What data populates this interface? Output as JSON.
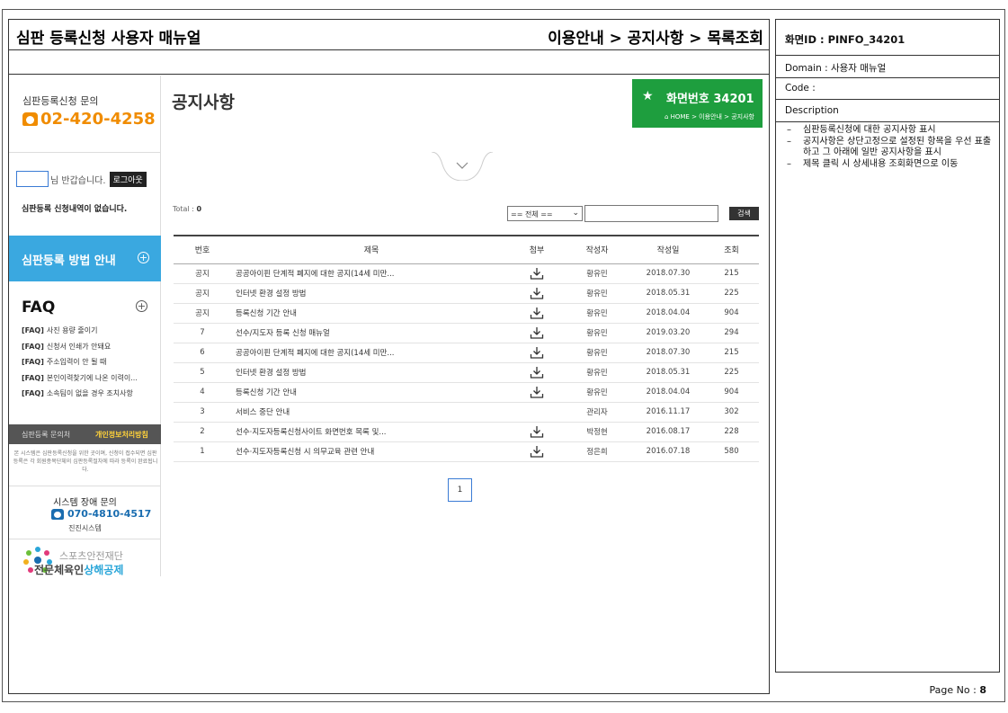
{
  "doc": {
    "title": "심판 등록신청 사용자 매뉴얼",
    "breadcrumb": "이용안내 > 공지사항 > 목록조회"
  },
  "sidebar": {
    "cs_label": "심판등록신청 문의",
    "cs_phone": "02-420-4258",
    "user_suffix": "님 반갑습니다.",
    "logout": "로그아웃",
    "no_request": "심판등록 신청내역이 없습니다.",
    "guide": "심판등록 방법 안내",
    "faq_title": "FAQ",
    "faq_items": [
      {
        "tag": "[FAQ]",
        "text": "사진 용량 줄이기"
      },
      {
        "tag": "[FAQ]",
        "text": "신청서 인쇄가 안돼요"
      },
      {
        "tag": "[FAQ]",
        "text": "주소입력이 안 될 때"
      },
      {
        "tag": "[FAQ]",
        "text": "본인이력찾기에 나온 이력이..."
      },
      {
        "tag": "[FAQ]",
        "text": "소속팀이 없을 경우 조치사항"
      }
    ],
    "bar_left": "심판등록 문의처",
    "bar_right": "개인정보처리방침",
    "notice_small": "본 시스템은 심판등록신청을 위한 곳이며, 신청이 접수되면 심판등록은 각 회원종목단체의 심판등록절차에 따라 등록이 완료됩니다.",
    "sys_label": "시스템 장애 문의",
    "sys_phone": "070-4810-4517",
    "sys_company": "진진시스템",
    "logo_top": "스포츠안전재단",
    "logo_bot_a": "전문체육인",
    "logo_bot_b": "상해공제"
  },
  "main": {
    "title": "공지사항",
    "badge_star": "★",
    "badge_num": "화면번호 34201",
    "badge_path": "HOME > 이용안내 > 공지사항",
    "total_label": "Total : ",
    "total_value": "0",
    "select_value": "== 전체 ==",
    "search_btn": "검색",
    "columns": [
      "번호",
      "제목",
      "첨부",
      "작성자",
      "작성일",
      "조회"
    ],
    "rows": [
      {
        "no": "공지",
        "title": "공공아이핀 단계적 폐지에 대한 공지(14세 미만...",
        "attach": true,
        "author": "황유민",
        "date": "2018.07.30",
        "views": "215"
      },
      {
        "no": "공지",
        "title": "인터넷 환경 설정 방법",
        "attach": true,
        "author": "황유민",
        "date": "2018.05.31",
        "views": "225"
      },
      {
        "no": "공지",
        "title": "등록신청 기간 안내",
        "attach": true,
        "author": "황유민",
        "date": "2018.04.04",
        "views": "904"
      },
      {
        "no": "7",
        "title": "선수/지도자 등록 신청 매뉴얼",
        "attach": true,
        "author": "황유민",
        "date": "2019.03.20",
        "views": "294"
      },
      {
        "no": "6",
        "title": "공공아이핀 단계적 폐지에 대한 공지(14세 미만...",
        "attach": true,
        "author": "황유민",
        "date": "2018.07.30",
        "views": "215"
      },
      {
        "no": "5",
        "title": "인터넷 환경 설정 방법",
        "attach": true,
        "author": "황유민",
        "date": "2018.05.31",
        "views": "225"
      },
      {
        "no": "4",
        "title": "등록신청 기간 안내",
        "attach": true,
        "author": "황유민",
        "date": "2018.04.04",
        "views": "904"
      },
      {
        "no": "3",
        "title": "서비스 중단 안내",
        "attach": false,
        "author": "관리자",
        "date": "2016.11.17",
        "views": "302"
      },
      {
        "no": "2",
        "title": "선수·지도자등록신청사이트 화면번호 목록 및...",
        "attach": true,
        "author": "박정현",
        "date": "2016.08.17",
        "views": "228"
      },
      {
        "no": "1",
        "title": "선수·지도자등록신청 시 의무교육 관련 안내",
        "attach": true,
        "author": "정은희",
        "date": "2016.07.18",
        "views": "580"
      }
    ],
    "page": "1"
  },
  "spec": {
    "screen_id": "화면ID : PINFO_34201",
    "domain": "Domain : 사용자 매뉴얼",
    "code": "Code :",
    "description": "Description",
    "desc_items": [
      "심판등록신청에 대한 공지사항 표시",
      "공지사항은 상단고정으로 설정된 항목을 우선 표출하고 그 아래에 일반 공지사항을 표시",
      "제목 클릭 시 상세내용 조회화면으로 이동"
    ],
    "page_no_label": "Page No : ",
    "page_no": "8"
  },
  "colors": {
    "accent_orange": "#f08c00",
    "guide_blue": "#3aa8e0",
    "badge_green": "#1e9e3e",
    "sys_blue": "#1a6db0"
  },
  "icons": [
    "phone-icon",
    "plus-circle-icon",
    "star-icon",
    "home-icon",
    "chevron-down-icon",
    "select-arrow-icon",
    "download-icon"
  ]
}
